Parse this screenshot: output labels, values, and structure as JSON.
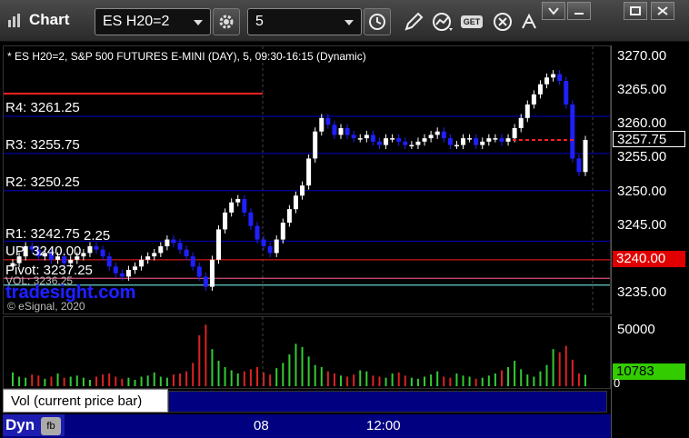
{
  "toolbar": {
    "title": "Chart",
    "symbol_value": "ES H20=2",
    "interval_value": "5",
    "get_badge": "GET"
  },
  "chart": {
    "header": "* ES H20=2, S&P 500 FUTURES E-MINI (DAY), 5, 09:30-16:15 (Dynamic)",
    "watermark": "tradesight.com",
    "copyright": "© eSignal, 2020",
    "current_price_tag": "3257.75",
    "level_price_tag": "3240.00",
    "level_labels": {
      "r4": "R4: 3261.25",
      "r3": "R3: 3255.75",
      "r2": "R2: 3250.25",
      "r1": "R1: 3242.75",
      "extra": "2.25",
      "up": "UP: 3240.00",
      "pivot": "Pivot: 3237.25",
      "vol": "VOL: 3236.25"
    }
  },
  "colors": {
    "up_candle": "#ffffff",
    "down_candle": "#2020ff",
    "level_blue": "#0000cc",
    "level_red": "#ff2020",
    "price_tag_red": "#e00000",
    "vol_tag_green": "#33cc00",
    "td_count_green": "#00cc00"
  },
  "chart_data": {
    "type": "candlestick",
    "price_axis": {
      "range": [
        3232,
        3272
      ],
      "ticks": [
        "3270.00",
        "3265.00",
        "3260.00",
        "3255.00",
        "3250.00",
        "3245.00",
        "3235.00"
      ]
    },
    "time_axis": {
      "ticks": [
        "08",
        "12:00"
      ]
    },
    "levels": [
      {
        "name": "R4",
        "value": 3261.25
      },
      {
        "name": "R3",
        "value": 3255.75
      },
      {
        "name": "R2",
        "value": 3250.25
      },
      {
        "name": "R1",
        "value": 3242.75
      },
      {
        "name": "UP",
        "value": 3240.0
      },
      {
        "name": "Pivot",
        "value": 3237.25
      },
      {
        "name": "VOL",
        "value": 3236.25
      }
    ],
    "close_series": [
      3239.5,
      3240.5,
      3242,
      3241.5,
      3240.5,
      3241,
      3240,
      3240.5,
      3239.5,
      3240,
      3240.5,
      3241,
      3242,
      3241.5,
      3240.5,
      3239,
      3238,
      3237.5,
      3238.5,
      3239,
      3240,
      3240.5,
      3241,
      3242,
      3243,
      3242.5,
      3241.5,
      3240.5,
      3239,
      3237.5,
      3236,
      3240,
      3244.5,
      3247,
      3248.5,
      3249,
      3247,
      3245,
      3243,
      3242,
      3241,
      3243,
      3245.5,
      3247.5,
      3249.5,
      3251,
      3255,
      3259,
      3261,
      3260,
      3258.5,
      3259.5,
      3258.5,
      3258,
      3258,
      3258.5,
      3257.5,
      3257,
      3258,
      3258,
      3257.5,
      3257,
      3257,
      3257.5,
      3258,
      3258.5,
      3259,
      3258,
      3257,
      3257,
      3258,
      3258,
      3257,
      3257.5,
      3258,
      3258,
      3257.5,
      3258,
      3259.5,
      3261,
      3263,
      3264.5,
      3266,
      3267,
      3267.5,
      3266.5,
      3263,
      3255,
      3253,
      3257.75
    ],
    "volume": {
      "axis_ticks": [
        "50000",
        "0"
      ],
      "last_value": "10783",
      "values": [
        13000,
        9000,
        8000,
        11000,
        10000,
        7000,
        9000,
        12000,
        8000,
        9000,
        10000,
        8000,
        6000,
        9000,
        11000,
        12000,
        9000,
        7000,
        8000,
        6000,
        9000,
        10000,
        13000,
        9000,
        8000,
        11000,
        12000,
        14000,
        22000,
        48000,
        58000,
        35000,
        24000,
        18000,
        15000,
        12000,
        14000,
        16000,
        18000,
        13000,
        11000,
        17000,
        22000,
        30000,
        40000,
        37000,
        28000,
        20000,
        18000,
        14000,
        12000,
        10000,
        9000,
        11000,
        15000,
        14000,
        10000,
        9000,
        8000,
        12000,
        13000,
        10000,
        8000,
        7000,
        9000,
        11000,
        14000,
        9000,
        8000,
        12000,
        10000,
        9000,
        7000,
        8000,
        10000,
        12000,
        15000,
        18000,
        24000,
        16000,
        11000,
        9000,
        14000,
        20000,
        35000,
        32000,
        38000,
        25000,
        12000,
        10783
      ]
    }
  },
  "legend": {
    "vol_label": "Vol (current price bar)",
    "close_glyph": "×"
  },
  "bottom": {
    "dyn_label": "Dyn",
    "dyn_icon": "fb"
  }
}
